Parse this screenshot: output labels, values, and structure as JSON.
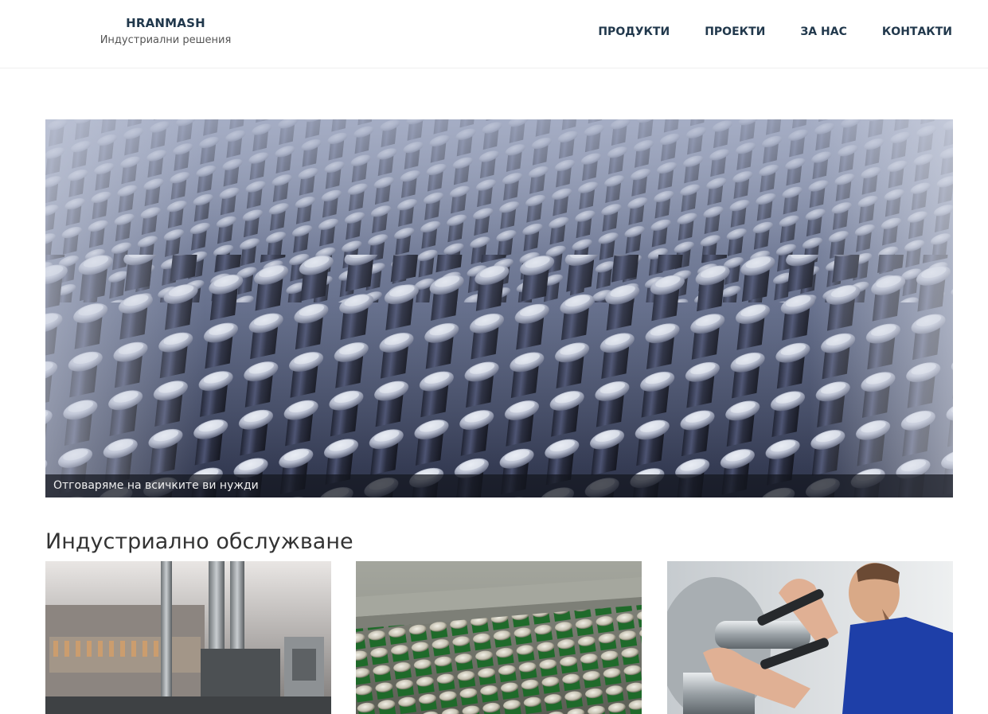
{
  "header": {
    "brand_name": "HRANMASH",
    "brand_tagline": "Индустриални решения",
    "nav": [
      {
        "label": "ПРОДУКТИ"
      },
      {
        "label": "ПРОЕКТИ"
      },
      {
        "label": "ЗА НАС"
      },
      {
        "label": "КОНТАКТИ"
      }
    ]
  },
  "hero": {
    "caption": "Отговаряме на всичките ви нужди"
  },
  "services": {
    "title": "Индустриално обслужване"
  },
  "colors": {
    "nav_text": "#21384c",
    "hero_tint": "#6d7895",
    "caption_bg": "#14161e"
  }
}
